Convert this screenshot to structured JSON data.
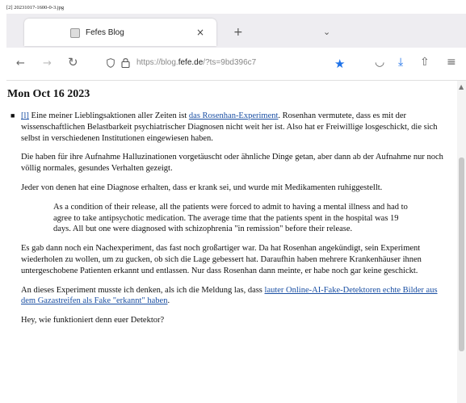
{
  "caption": "[2] 20231017-1600-0-3.jpg",
  "tab": {
    "title": "Fefes Blog",
    "close": "×",
    "new_tab": "+",
    "list": "⌄"
  },
  "nav": {
    "back": "←",
    "forward": "→",
    "reload": "↻"
  },
  "url": {
    "prefix": "https://blog.",
    "domain": "fefe.de",
    "suffix": "/?ts=9bd396c7"
  },
  "toolbar": {
    "bookmark": "★",
    "pocket": "◡",
    "download": "⤓",
    "extensions": "⇧",
    "menu": "≡"
  },
  "post": {
    "date": "Mon Oct 16 2023",
    "bullet": "■",
    "permalink": "[l]",
    "p1_before": " Eine meiner Lieblingsaktionen aller Zeiten ist ",
    "p1_link": "das Rosenhan-Experiment",
    "p1_after": ". Rosenhan vermutete, dass es mit der wissenschaftlichen Belastbarkeit psychiatrischer Diagnosen nicht weit her ist. Also hat er Freiwillige losgeschickt, die sich selbst in verschiedenen Institutionen eingewiesen haben.",
    "p2": "Die haben für ihre Aufnahme Halluzinationen vorgetäuscht oder ähnliche Dinge getan, aber dann ab der Aufnahme nur noch völlig normales, gesundes Verhalten gezeigt.",
    "p3": "Jeder von denen hat eine Diagnose erhalten, dass er krank sei, und wurde mit Medikamenten ruhiggestellt.",
    "quote": "As a condition of their release, all the patients were forced to admit to having a mental illness and had to agree to take antipsychotic medication. The average time that the patients spent in the hospital was 19 days. All but one were diagnosed with schizophrenia \"in remission\" before their release.",
    "p4": "Es gab dann noch ein Nachexperiment, das fast noch großartiger war. Da hat Rosenhan angekündigt, sein Experiment wiederholen zu wollen, um zu gucken, ob sich die Lage gebessert hat. Daraufhin haben mehrere Krankenhäuser ihnen untergeschobene Patienten erkannt und entlassen. Nur dass Rosenhan dann meinte, er habe noch gar keine geschickt.",
    "p5_before": "An dieses Experiment musste ich denken, als ich die Meldung las, dass ",
    "p5_link": "lauter Online-AI-Fake-Detektoren echte Bilder aus dem Gazastreifen als Fake \"erkannt\" haben",
    "p5_after": ".",
    "p6": "Hey, wie funktioniert denn euer Detektor?"
  }
}
